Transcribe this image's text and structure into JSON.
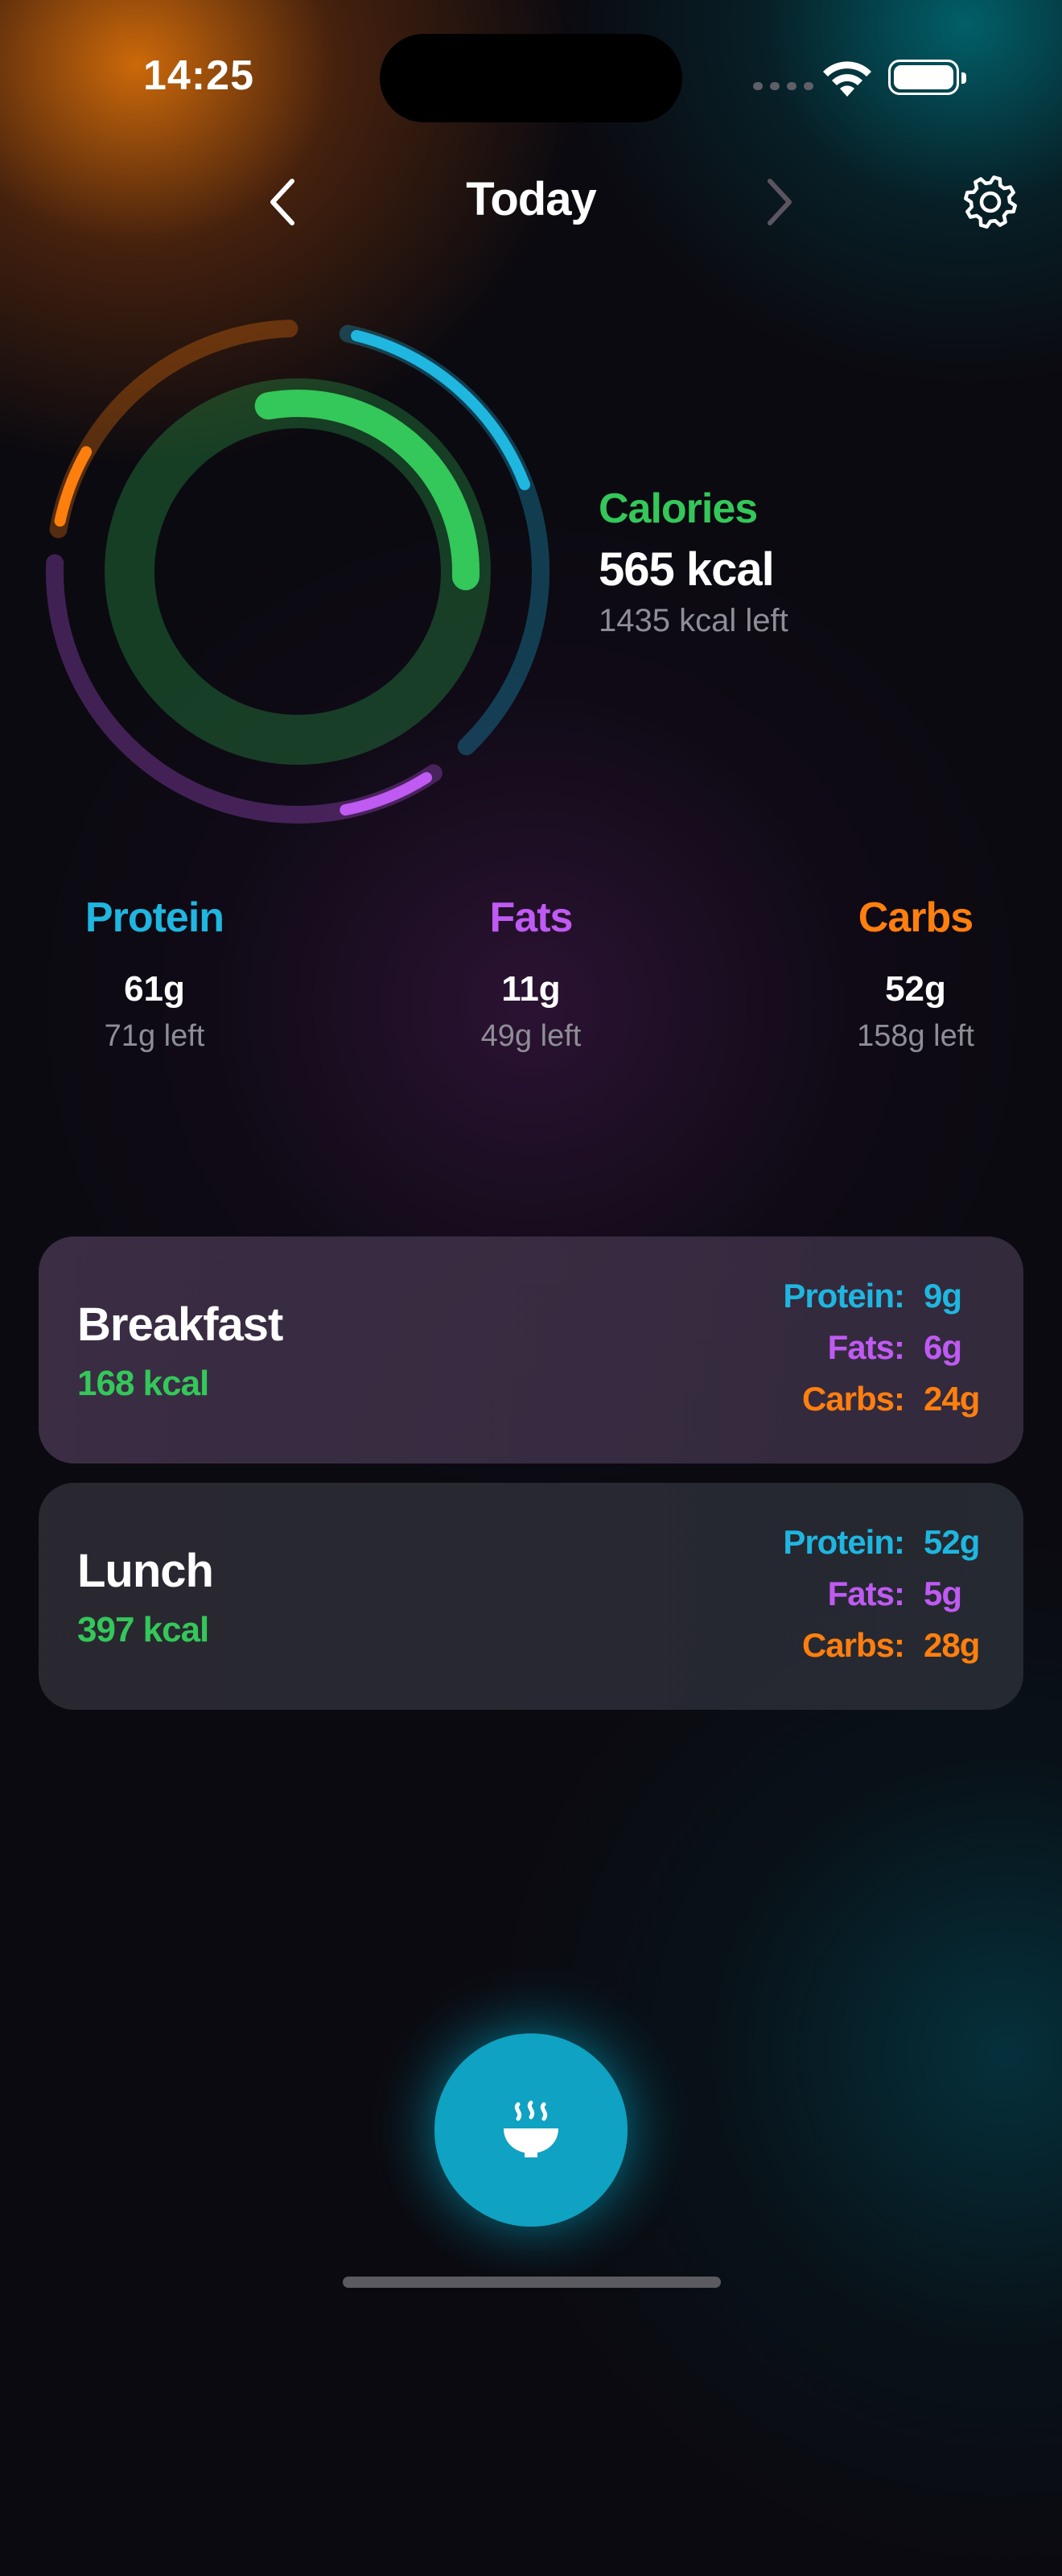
{
  "status_bar": {
    "time": "14:25"
  },
  "nav": {
    "title": "Today",
    "prev_icon": "chevron-left-icon",
    "next_icon": "chevron-right-icon",
    "settings_icon": "gear-icon"
  },
  "summary": {
    "calories": {
      "label": "Calories",
      "value": "565 kcal",
      "left": "1435 kcal left",
      "progress": 0.2825
    },
    "protein": {
      "label": "Protein",
      "value": "61g",
      "left": "71g left",
      "progress": 0.46
    },
    "fats": {
      "label": "Fats",
      "value": "11g",
      "left": "49g left",
      "progress": 0.18
    },
    "carbs": {
      "label": "Carbs",
      "value": "52g",
      "left": "158g left",
      "progress": 0.25
    }
  },
  "meals": [
    {
      "name": "Breakfast",
      "kcal": "168 kcal",
      "protein_label": "Protein:",
      "protein": "9g",
      "fats_label": "Fats:",
      "fats": "6g",
      "carbs_label": "Carbs:",
      "carbs": "24g"
    },
    {
      "name": "Lunch",
      "kcal": "397 kcal",
      "protein_label": "Protein:",
      "protein": "52g",
      "fats_label": "Fats:",
      "fats": "5g",
      "carbs_label": "Carbs:",
      "carbs": "28g"
    }
  ],
  "fab": {
    "icon": "steaming-bowl-icon"
  },
  "colors": {
    "calories": "#34c759",
    "protein": "#1fb6e0",
    "fats": "#bf5af2",
    "carbs": "#ff7f0e"
  }
}
